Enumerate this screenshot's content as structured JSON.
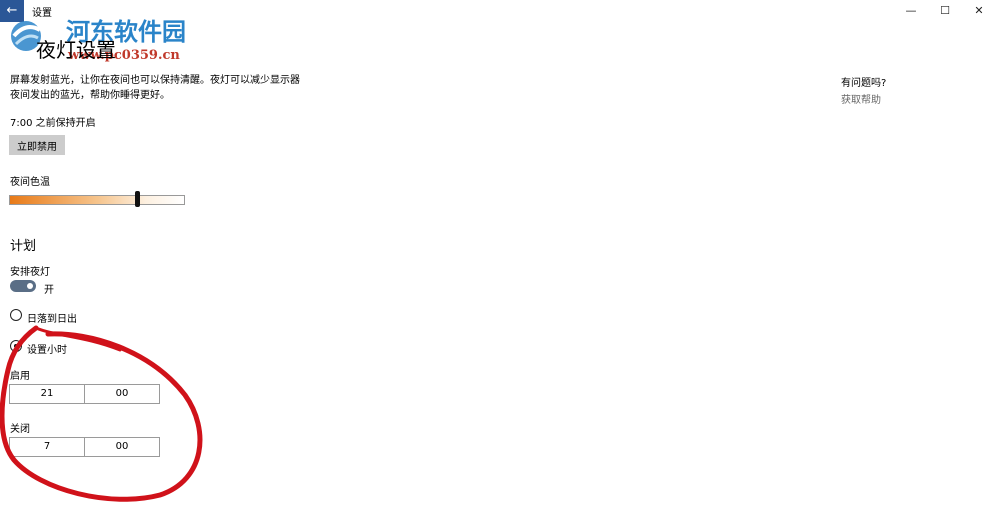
{
  "window": {
    "back_glyph": "←",
    "title": "设置",
    "min_glyph": "—",
    "max_glyph": "☐",
    "close_glyph": "✕"
  },
  "watermark": {
    "name": "河东软件园",
    "url": "www.pc0359.cn"
  },
  "page": {
    "title": "夜灯设置",
    "description": "屏幕发射蓝光，让你在夜间也可以保持清醒。夜灯可以减少显示器夜间发出的蓝光，帮助你睡得更好。",
    "keep_on_until": "7:00 之前保持开启",
    "disable_button": "立即禁用",
    "color_temp_label": "夜间色温",
    "color_temp_level": 0.73
  },
  "schedule": {
    "section_title": "计划",
    "toggle_label": "安排夜灯",
    "toggle_state": "开",
    "toggle_on": true,
    "radio_sunset": "日落到日出",
    "radio_hours": "设置小时",
    "selected": "radio_hours",
    "turn_on_label": "启用",
    "turn_on_hour": "21",
    "turn_on_minute": "00",
    "turn_off_label": "关闭",
    "turn_off_hour": "7",
    "turn_off_minute": "00"
  },
  "help": {
    "question": "有问题吗?",
    "link": "获取帮助"
  },
  "colors": {
    "accent": "#2b5797",
    "toggle_on": "#5a6e86",
    "annotation": "#d0121a",
    "watermark_text": "#2a84c9",
    "watermark_url": "#c0392b"
  }
}
